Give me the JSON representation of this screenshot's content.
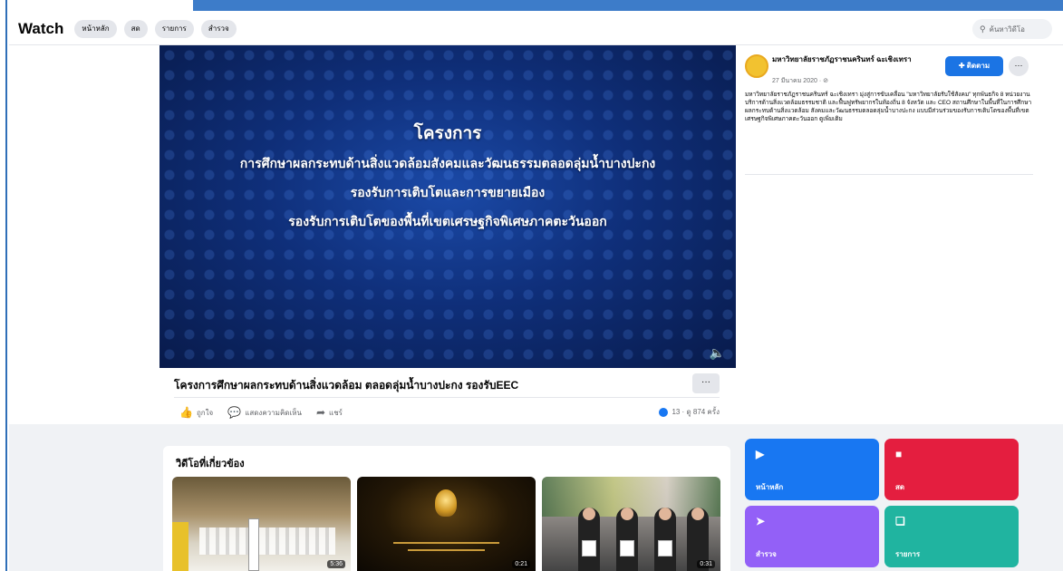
{
  "header": {
    "title": "Watch",
    "chips": [
      "หน้าหลัก",
      "สด",
      "รายการ",
      "สำรวจ"
    ],
    "search_placeholder": "ค้นหาวิดีโอ"
  },
  "video": {
    "overlay_lines": [
      "โครงการ",
      "การศึกษาผลกระทบด้านสิ่งแวดล้อมสังคมและวัฒนธรรมตลอดลุ่มน้ำบางปะกง",
      "รองรับการเติบโตและการขยายเมือง",
      "รองรับการเติบโตของพื้นที่เขตเศรษฐกิจพิเศษภาคตะวันออก"
    ],
    "title": "โครงการศึกษาผลกระทบด้านสิ่งแวดล้อม ตลอดลุ่มน้ำบางปะกง รองรับEEC",
    "more_label": "···",
    "actions": [
      "ถูกใจ",
      "แสดงความคิดเห็น",
      "แชร์"
    ],
    "views": "13 · ดู 874 ครั้ง"
  },
  "sidebar": {
    "page_name": "มหาวิทยาลัยราชภัฏราชนครินทร์ ฉะเชิงเทรา",
    "post_date": "27 มีนาคม 2020 · ⊘",
    "follow_label": "ติดตาม",
    "more_label": "···",
    "description": "มหาวิทยาลัยราชภัฏราชนครินทร์ ฉะเชิงเทรา มุ่งสู่การขับเคลื่อน \"มหาวิทยาลัยรับใช้สังคม\" ทุกพันธกิจ 8 หน่วยงานบริการด้านสิ่งแวดล้อมธรรมชาติ และฟื้นฟูทรัพยากรในท้องถิ่น 8 จังหวัด และ CEO สถานศึกษาในพื้นที่ในการศึกษาผลกระทบด้านสิ่งแวดล้อม สังคมและวัฒนธรรมตลอดลุ่มน้ำบางปะกง แบบมีส่วนร่วมของรับการเติบโตของพื้นที่เขตเศรษฐกิจพิเศษภาคตะวันออก ดูเพิ่มเติม"
  },
  "related": {
    "title": "วิดีโอที่เกี่ยวข้อง",
    "videos": [
      {
        "duration": "5:36"
      },
      {
        "duration": "0:21"
      },
      {
        "duration": "0:31"
      }
    ]
  },
  "shortcuts": [
    {
      "label": "หน้าหลัก",
      "color": "#1877f2"
    },
    {
      "label": "สด",
      "color": "#e41e3f"
    },
    {
      "label": "สำรวจ",
      "color": "#9360f7"
    },
    {
      "label": "รายการ",
      "color": "#20b4a0"
    }
  ]
}
